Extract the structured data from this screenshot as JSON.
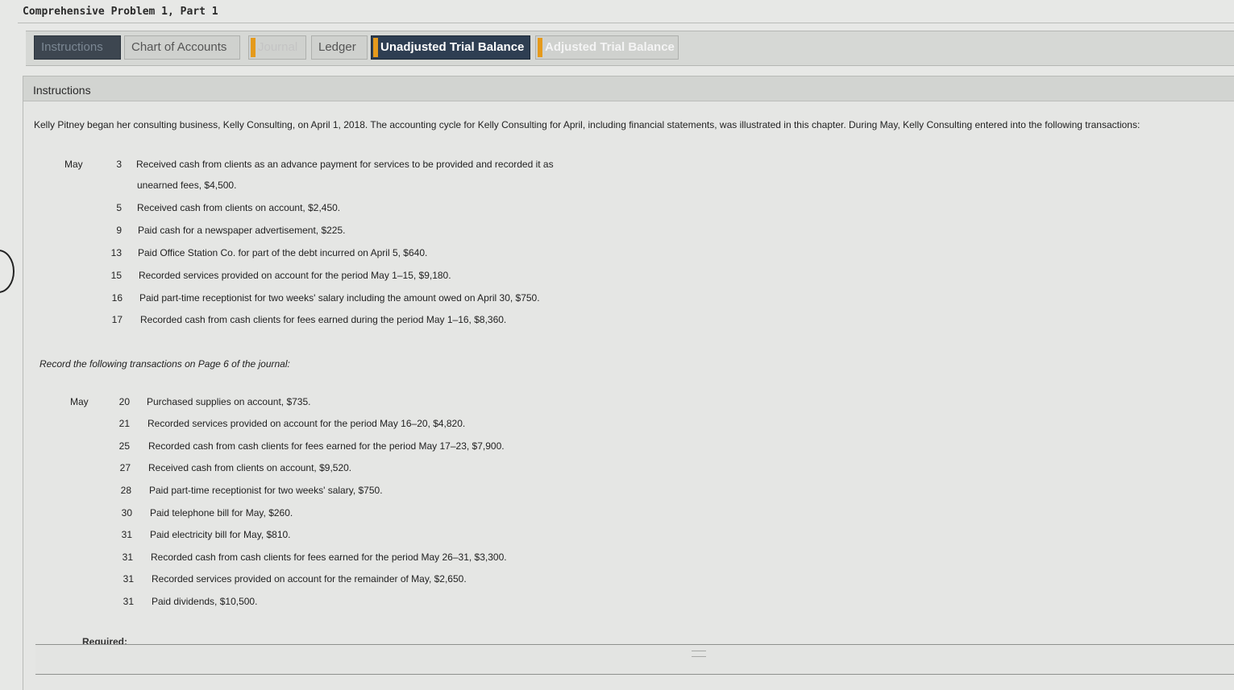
{
  "page_title": "Comprehensive Problem 1, Part 1",
  "tabs": [
    {
      "label": "Instructions",
      "state": "current-dark",
      "flag": false
    },
    {
      "label": "Chart of Accounts",
      "state": "normal",
      "flag": false
    },
    {
      "label": "Journal",
      "state": "faded",
      "flag": true
    },
    {
      "label": "Ledger",
      "state": "normal",
      "flag": false
    },
    {
      "label": "Unadjusted Trial Balance",
      "state": "active",
      "flag": true
    },
    {
      "label": "Adjusted Trial Balance",
      "state": "faded",
      "flag": true
    }
  ],
  "panel_header": "Instructions",
  "intro": "Kelly Pitney began her consulting business, Kelly Consulting, on April 1, 2018. The accounting cycle for Kelly Consulting for April, including financial statements, was illustrated in this chapter. During May, Kelly Consulting entered into the following transactions:",
  "group1": {
    "month": "May",
    "transactions": [
      {
        "day": "3",
        "desc": "Received cash from clients as an advance payment for services to be provided and recorded it as"
      },
      {
        "day": "",
        "desc": "unearned fees, $4,500."
      },
      {
        "day": "5",
        "desc": "Received cash from clients on account, $2,450."
      },
      {
        "day": "9",
        "desc": "Paid cash for a newspaper advertisement, $225."
      },
      {
        "day": "13",
        "desc": "Paid Office Station Co. for part of the debt incurred on April 5, $640."
      },
      {
        "day": "15",
        "desc": "Recorded services provided on account for the period May 1–15, $9,180."
      },
      {
        "day": "16",
        "desc": "Paid part-time receptionist for two weeks' salary including the amount owed on April 30, $750."
      },
      {
        "day": "17",
        "desc": "Recorded cash from cash clients for fees earned during the period May 1–16, $8,360."
      }
    ]
  },
  "record_note": "Record the following transactions on Page 6 of the journal:",
  "group2": {
    "month": "May",
    "transactions": [
      {
        "day": "20",
        "desc": "Purchased supplies on account, $735."
      },
      {
        "day": "21",
        "desc": "Recorded services provided on account for the period May 16–20, $4,820."
      },
      {
        "day": "25",
        "desc": "Recorded cash from cash clients for fees earned for the period May 17–23, $7,900."
      },
      {
        "day": "27",
        "desc": "Received cash from clients on account, $9,520."
      },
      {
        "day": "28",
        "desc": "Paid part-time receptionist for two weeks' salary, $750."
      },
      {
        "day": "30",
        "desc": "Paid telephone bill for May, $260."
      },
      {
        "day": "31",
        "desc": "Paid electricity bill for May, $810."
      },
      {
        "day": "31",
        "desc": "Recorded cash from cash clients for fees earned for the period May 26–31, $3,300."
      },
      {
        "day": "31",
        "desc": "Recorded services provided on account for the remainder of May, $2,650."
      },
      {
        "day": "31",
        "desc": "Paid dividends, $10,500."
      }
    ]
  },
  "required_label": "Required:",
  "colors": {
    "active_tab": "#2e3e52",
    "flag": "#e59a1c",
    "panel_header": "#d2d4d1"
  }
}
